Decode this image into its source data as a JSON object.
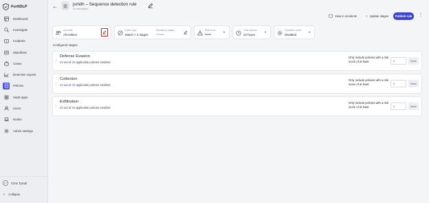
{
  "app": {
    "name": "FortiDLP"
  },
  "sidebar": {
    "items": [
      {
        "label": "Dashboard",
        "icon": "dashboard-icon"
      },
      {
        "label": "Investigate",
        "icon": "search-icon"
      },
      {
        "label": "Incidents",
        "icon": "incidents-icon"
      },
      {
        "label": "Watchlists",
        "icon": "watchlist-icon"
      },
      {
        "label": "Cases",
        "icon": "briefcase-icon"
      },
      {
        "label": "Detection reports",
        "icon": "chart-icon"
      },
      {
        "label": "Policies",
        "icon": "policy-icon",
        "active": true
      },
      {
        "label": "SaaS apps",
        "icon": "apps-icon"
      },
      {
        "label": "Users",
        "icon": "user-icon"
      },
      {
        "label": "Nodes",
        "icon": "laptop-icon"
      },
      {
        "label": "Admin settings",
        "icon": "gear-icon"
      }
    ],
    "user": {
      "initials": "CT",
      "name": "Chris Tyrrall"
    },
    "collapse_label": "Collapse"
  },
  "header": {
    "title": "jsmith – Sequence detection rule",
    "subtitle": "no description",
    "view_incidents": "View in incidents",
    "update_stages": "Update stages",
    "publish": "Publish rule"
  },
  "filters": {
    "annotate": {
      "label": "Annotate",
      "value": "All entities"
    },
    "match_type": {
      "label": "Match type",
      "value": "Match > 2 stages"
    },
    "mandatory": {
      "label": "Mandatory stages",
      "value": "<None>"
    },
    "risk": {
      "label": "Risk score",
      "value": "None"
    },
    "time_window": {
      "label": "Time window",
      "value": "24 hours"
    },
    "operation": {
      "label": "Operation mode",
      "value": "Disabled"
    }
  },
  "section_label": "Configured stages",
  "stages": [
    {
      "name": "Defense Evasion",
      "enabled": "29",
      "of": "out of",
      "total": "29",
      "suffix": "applicable policies enabled",
      "note": "Only include policies with a risk score of at least",
      "score": "0",
      "severity": "None"
    },
    {
      "name": "Collection",
      "enabled": "33",
      "of": "out of",
      "total": "33",
      "suffix": "applicable policies enabled",
      "note": "Only include policies with a risk score of at least",
      "score": "0",
      "severity": "None"
    },
    {
      "name": "Exfiltration",
      "enabled": "25",
      "of": "out of",
      "total": "25",
      "suffix": "applicable policies enabled",
      "note": "Only include policies with a risk score of at least",
      "score": "0",
      "severity": "None"
    }
  ],
  "colors": {
    "accent": "#3d46c9",
    "highlight": "#d6232a"
  }
}
